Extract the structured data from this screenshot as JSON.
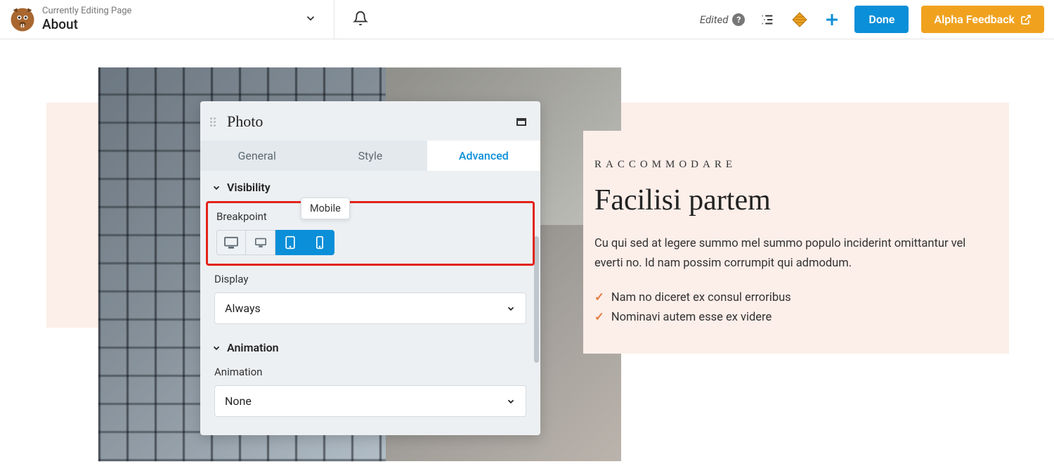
{
  "header": {
    "editing_label": "Currently Editing Page",
    "page_title": "About",
    "edited_label": "Edited",
    "done_label": "Done",
    "feedback_label": "Alpha Feedback"
  },
  "panel": {
    "title": "Photo",
    "tabs": [
      "General",
      "Style",
      "Advanced"
    ],
    "active_tab": 2,
    "sections": {
      "visibility": {
        "label": "Visibility",
        "breakpoint_label": "Breakpoint",
        "breakpoints": [
          {
            "name": "large-desktop",
            "active": false
          },
          {
            "name": "desktop",
            "active": false
          },
          {
            "name": "tablet",
            "active": true
          },
          {
            "name": "mobile",
            "active": true
          }
        ],
        "tooltip_label": "Mobile",
        "display_label": "Display",
        "display_value": "Always"
      },
      "animation": {
        "label": "Animation",
        "animation_label": "Animation",
        "animation_value": "None"
      }
    }
  },
  "content": {
    "eyebrow": "RACCOMMODARE",
    "headline": "Facilisi partem",
    "body": "Cu qui sed at legere summo mel summo populo inciderint omittantur vel everti no. Id nam possim corrumpit qui admodum.",
    "bullets": [
      "Nam no diceret ex consul erroribus",
      "Nominavi autem esse ex videre"
    ]
  },
  "colors": {
    "primary": "#0a8fd8",
    "accent": "#f0a21e",
    "highlight": "#e2231a",
    "blush": "#fceee9",
    "check": "#e47b3e"
  }
}
